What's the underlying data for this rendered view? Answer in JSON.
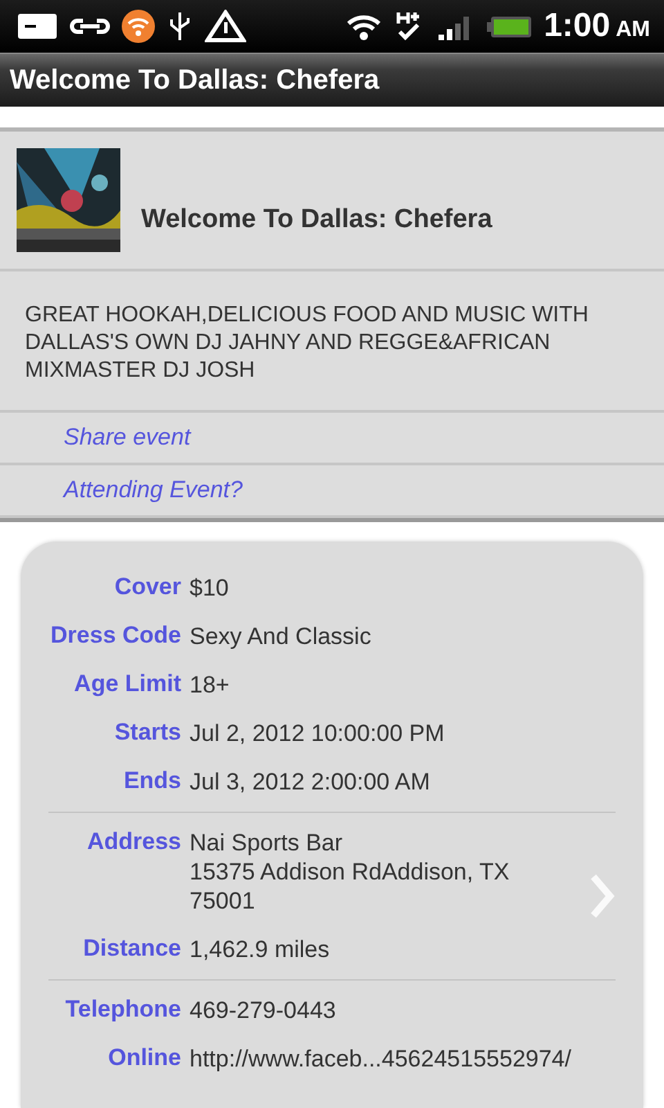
{
  "status_bar": {
    "time": "1:00",
    "meridiem": "AM"
  },
  "title_bar": {
    "title": "Welcome To Dallas: Chefera"
  },
  "event": {
    "name": "Welcome To Dallas: Chefera",
    "description": "GREAT HOOKAH,DELICIOUS FOOD AND MUSIC WITH DALLAS'S OWN DJ JAHNY AND REGGE&AFRICAN MIXMASTER DJ JOSH"
  },
  "actions": [
    {
      "label": "Share event"
    },
    {
      "label": "Attending Event?"
    }
  ],
  "details": [
    {
      "chevron": false,
      "rows": [
        {
          "label": "Cover",
          "lines": [
            "$10"
          ]
        },
        {
          "label": "Dress Code",
          "lines": [
            "Sexy And Classic"
          ]
        },
        {
          "label": "Age Limit",
          "lines": [
            "18+"
          ]
        },
        {
          "label": "Starts",
          "lines": [
            "Jul 2, 2012 10:00:00 PM"
          ]
        },
        {
          "label": "Ends",
          "lines": [
            "Jul 3, 2012 2:00:00 AM"
          ]
        }
      ]
    },
    {
      "chevron": true,
      "rows": [
        {
          "label": "Address",
          "lines": [
            "Nai Sports Bar",
            "15375 Addison RdAddison, TX",
            "75001"
          ]
        },
        {
          "label": "Distance",
          "lines": [
            "1,462.9 miles"
          ]
        }
      ]
    },
    {
      "chevron": false,
      "rows": [
        {
          "label": "Telephone",
          "lines": [
            "469-279-0443"
          ]
        },
        {
          "label": "Online",
          "lines": [
            "http://www.faceb...45624515552974/"
          ]
        }
      ]
    }
  ]
}
